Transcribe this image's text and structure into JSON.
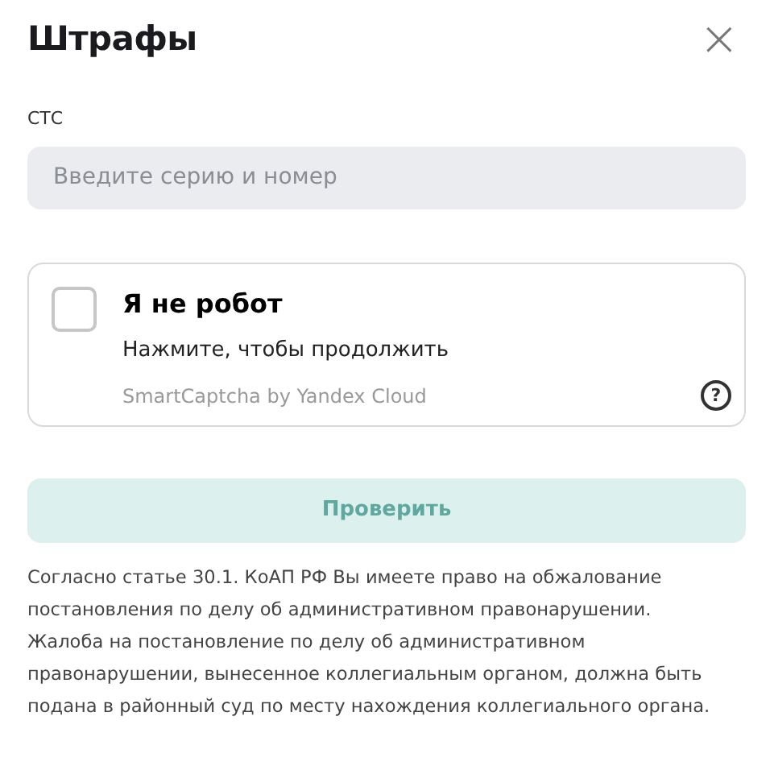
{
  "dialog": {
    "title": "Штрафы",
    "close": "×"
  },
  "field": {
    "label": "СТС",
    "placeholder": "Введите серию и номер"
  },
  "captcha": {
    "checked": false,
    "title": "Я не робот",
    "subtitle": "Нажмите, чтобы продолжить",
    "brand": "SmartCaptcha by Yandex Cloud",
    "help": "?"
  },
  "submit": {
    "label": "Проверить",
    "disabled": true
  },
  "notice": "Согласно статье 30.1. КоАП РФ Вы имеете право на обжалование постановления по делу об административном правонарушении. Жалоба на постановление по делу об административном правонарушении, вынесенное коллегиальным органом, должна быть подана в районный суд по месту нахождения коллегиального органа."
}
